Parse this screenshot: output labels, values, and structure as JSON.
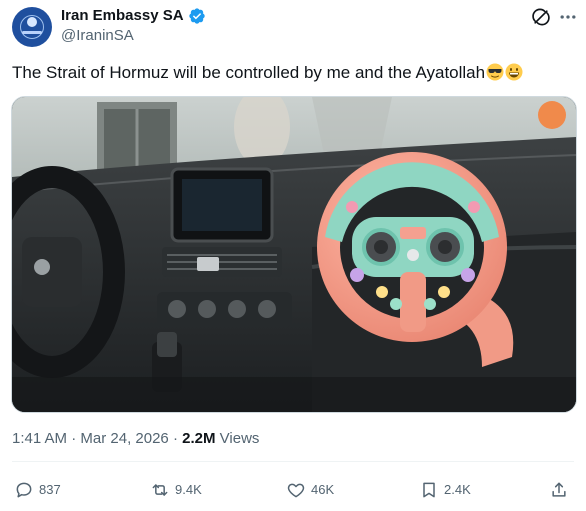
{
  "author": {
    "display_name": "Iran Embassy SA",
    "handle": "@IraninSA",
    "avatar_icon": "iran-embassy-emblem-avatar",
    "verified_icon": "verified-badge-icon",
    "verified_color": "#1d9bf0"
  },
  "header_actions": [
    "grok-icon",
    "more-icon"
  ],
  "tweet": {
    "text": "The Strait of Hormuz will be controlled by me and the Ayatollah",
    "emojis": [
      "sunglasses-face-emoji",
      "grinning-face-emoji"
    ]
  },
  "media": {
    "kind": "photo",
    "subject": "toy steering wheel mounted on a car dashboard"
  },
  "meta": {
    "time": "1:41 AM",
    "separator": "·",
    "date": "Mar 24, 2026",
    "views_count": "2.2M",
    "views_label": "Views"
  },
  "actions": {
    "replies": "837",
    "reposts": "9.4K",
    "likes": "46K",
    "bookmarks": "2.4K"
  },
  "colors": {
    "text": "#0f1419",
    "secondary": "#536471",
    "accent": "#1d9bf0"
  }
}
